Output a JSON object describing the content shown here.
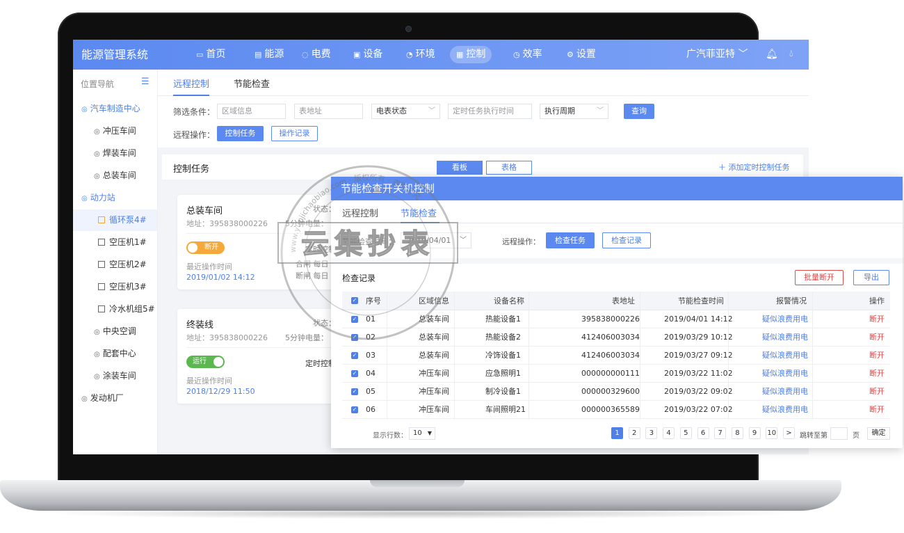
{
  "app": {
    "title": "能源管理系统"
  },
  "nav": {
    "items": [
      {
        "label": "首页",
        "icon": "▭"
      },
      {
        "label": "能源",
        "icon": "▤"
      },
      {
        "label": "电费",
        "icon": "◌"
      },
      {
        "label": "设备",
        "icon": "▣"
      },
      {
        "label": "环境",
        "icon": "◔"
      },
      {
        "label": "控制",
        "icon": "▦"
      },
      {
        "label": "效率",
        "icon": "◷"
      },
      {
        "label": "设置",
        "icon": "⚙"
      }
    ],
    "active_index": 5,
    "org": "广汽菲亚特 ﹀",
    "bell_icon": "bell-icon",
    "drop_icon": "water-drop-icon"
  },
  "sidebar": {
    "header": "位置导航",
    "toggle_icon": "☰",
    "items": [
      {
        "label": "汽车制造中心",
        "type": "group"
      },
      {
        "label": "冲压车间",
        "type": "sub"
      },
      {
        "label": "焊装车间",
        "type": "sub"
      },
      {
        "label": "总装车间",
        "type": "sub"
      },
      {
        "label": "动力站",
        "type": "group"
      },
      {
        "label": "循环泵4#",
        "type": "device",
        "selected": true
      },
      {
        "label": "空压机1#",
        "type": "device"
      },
      {
        "label": "空压机2#",
        "type": "device"
      },
      {
        "label": "空压机3#",
        "type": "device"
      },
      {
        "label": "冷水机组5#",
        "type": "device"
      },
      {
        "label": "中央空调",
        "type": "sub"
      },
      {
        "label": "配套中心",
        "type": "sub"
      },
      {
        "label": "涂装车间",
        "type": "sub"
      },
      {
        "label": "发动机厂",
        "type": "top"
      }
    ]
  },
  "main": {
    "tabs": [
      {
        "label": "远程控制"
      },
      {
        "label": "节能检查"
      }
    ],
    "filter": {
      "label": "筛选条件：",
      "area_placeholder": "区域信息",
      "meter_placeholder": "表地址",
      "status_select": "电表状态",
      "time_placeholder": "定时任务执行时间",
      "cycle_select": "执行周期",
      "query_label": "查询"
    },
    "remote": {
      "label": "远程操作：",
      "task_button": "控制任务",
      "log_button": "操作记录"
    },
    "task_panel": {
      "title": "控制任务",
      "seg_board": "看板",
      "seg_table": "表格",
      "add_label": "＋ 添加定时控制任务"
    },
    "cards": [
      {
        "name": "总装车间",
        "addr": "地址：395838000226",
        "status": "状态：",
        "elec": "5分钟电量：",
        "toggle": "断开",
        "ctrl": "定时控制",
        "sub1": "合闸 每日",
        "sub2": "断闸 每日",
        "opt_label": "最近操作时间",
        "opt_time": "2019/01/02 14:12"
      },
      {
        "name": "终装线",
        "addr": "地址：395838000226",
        "status": "状态：",
        "elec": "5分钟电量：",
        "toggle": "运行",
        "ctrl": "定时控制",
        "opt_label": "最近操作时间",
        "opt_time": "2018/12/29 11:50"
      }
    ]
  },
  "popup": {
    "title": "节能检查开关机控制",
    "tabs": [
      {
        "label": "远程控制"
      },
      {
        "label": "节能检查"
      }
    ],
    "date_label": "节能检查时间：",
    "date_value": "2019/04/01",
    "remote_label": "远程操作：",
    "check_task": "检查任务",
    "check_log": "检查记录",
    "records_title": "检查记录",
    "batch_off": "批量断开",
    "export": "导出",
    "columns": [
      "序号",
      "区域信息",
      "设备名称",
      "表地址",
      "节能检查时间",
      "报警情况",
      "操作"
    ],
    "rows": [
      {
        "no": "01",
        "area": "总装车间",
        "device": "热能设备1",
        "meter": "395838000226",
        "time": "2019/04/01 14:12",
        "alarm": "疑似浪费用电",
        "action": "断开"
      },
      {
        "no": "02",
        "area": "总装车间",
        "device": "热能设备2",
        "meter": "412406003034",
        "time": "2019/03/29 10:12",
        "alarm": "疑似浪费用电",
        "action": "断开"
      },
      {
        "no": "03",
        "area": "总装车间",
        "device": "冷饰设备1",
        "meter": "412406003034",
        "time": "2019/03/27 09:12",
        "alarm": "疑似浪费用电",
        "action": "断开"
      },
      {
        "no": "04",
        "area": "冲压车间",
        "device": "应急照明1",
        "meter": "000000000111",
        "time": "2019/03/22 11:02",
        "alarm": "疑似浪费用电",
        "action": "断开"
      },
      {
        "no": "05",
        "area": "冲压车间",
        "device": "制冷设备1",
        "meter": "000000329600",
        "time": "2019/03/22 09:02",
        "alarm": "疑似浪费用电",
        "action": "断开"
      },
      {
        "no": "06",
        "area": "冲压车间",
        "device": "车间照明21",
        "meter": "000000365589",
        "time": "2019/03/22 07:02",
        "alarm": "疑似浪费用电",
        "action": "断开"
      }
    ],
    "pagination": {
      "rows_label": "显示行数：",
      "rows_value": "10",
      "pages": [
        "1",
        "2",
        "3",
        "4",
        "5",
        "6",
        "7",
        "8",
        "9",
        "10"
      ],
      "current": "1",
      "next": ">",
      "jump_label": "跳转至第",
      "page_unit": "页",
      "confirm": "确定"
    }
  },
  "watermark": {
    "text": "云集抄表",
    "ring_text": "www.yunjichaobiao.com · 版权所有 · 盗图必究"
  },
  "colors": {
    "accent": "#5b89f0",
    "danger": "#e24a4a",
    "warning": "#f6a93b",
    "success": "#5ab84f"
  }
}
